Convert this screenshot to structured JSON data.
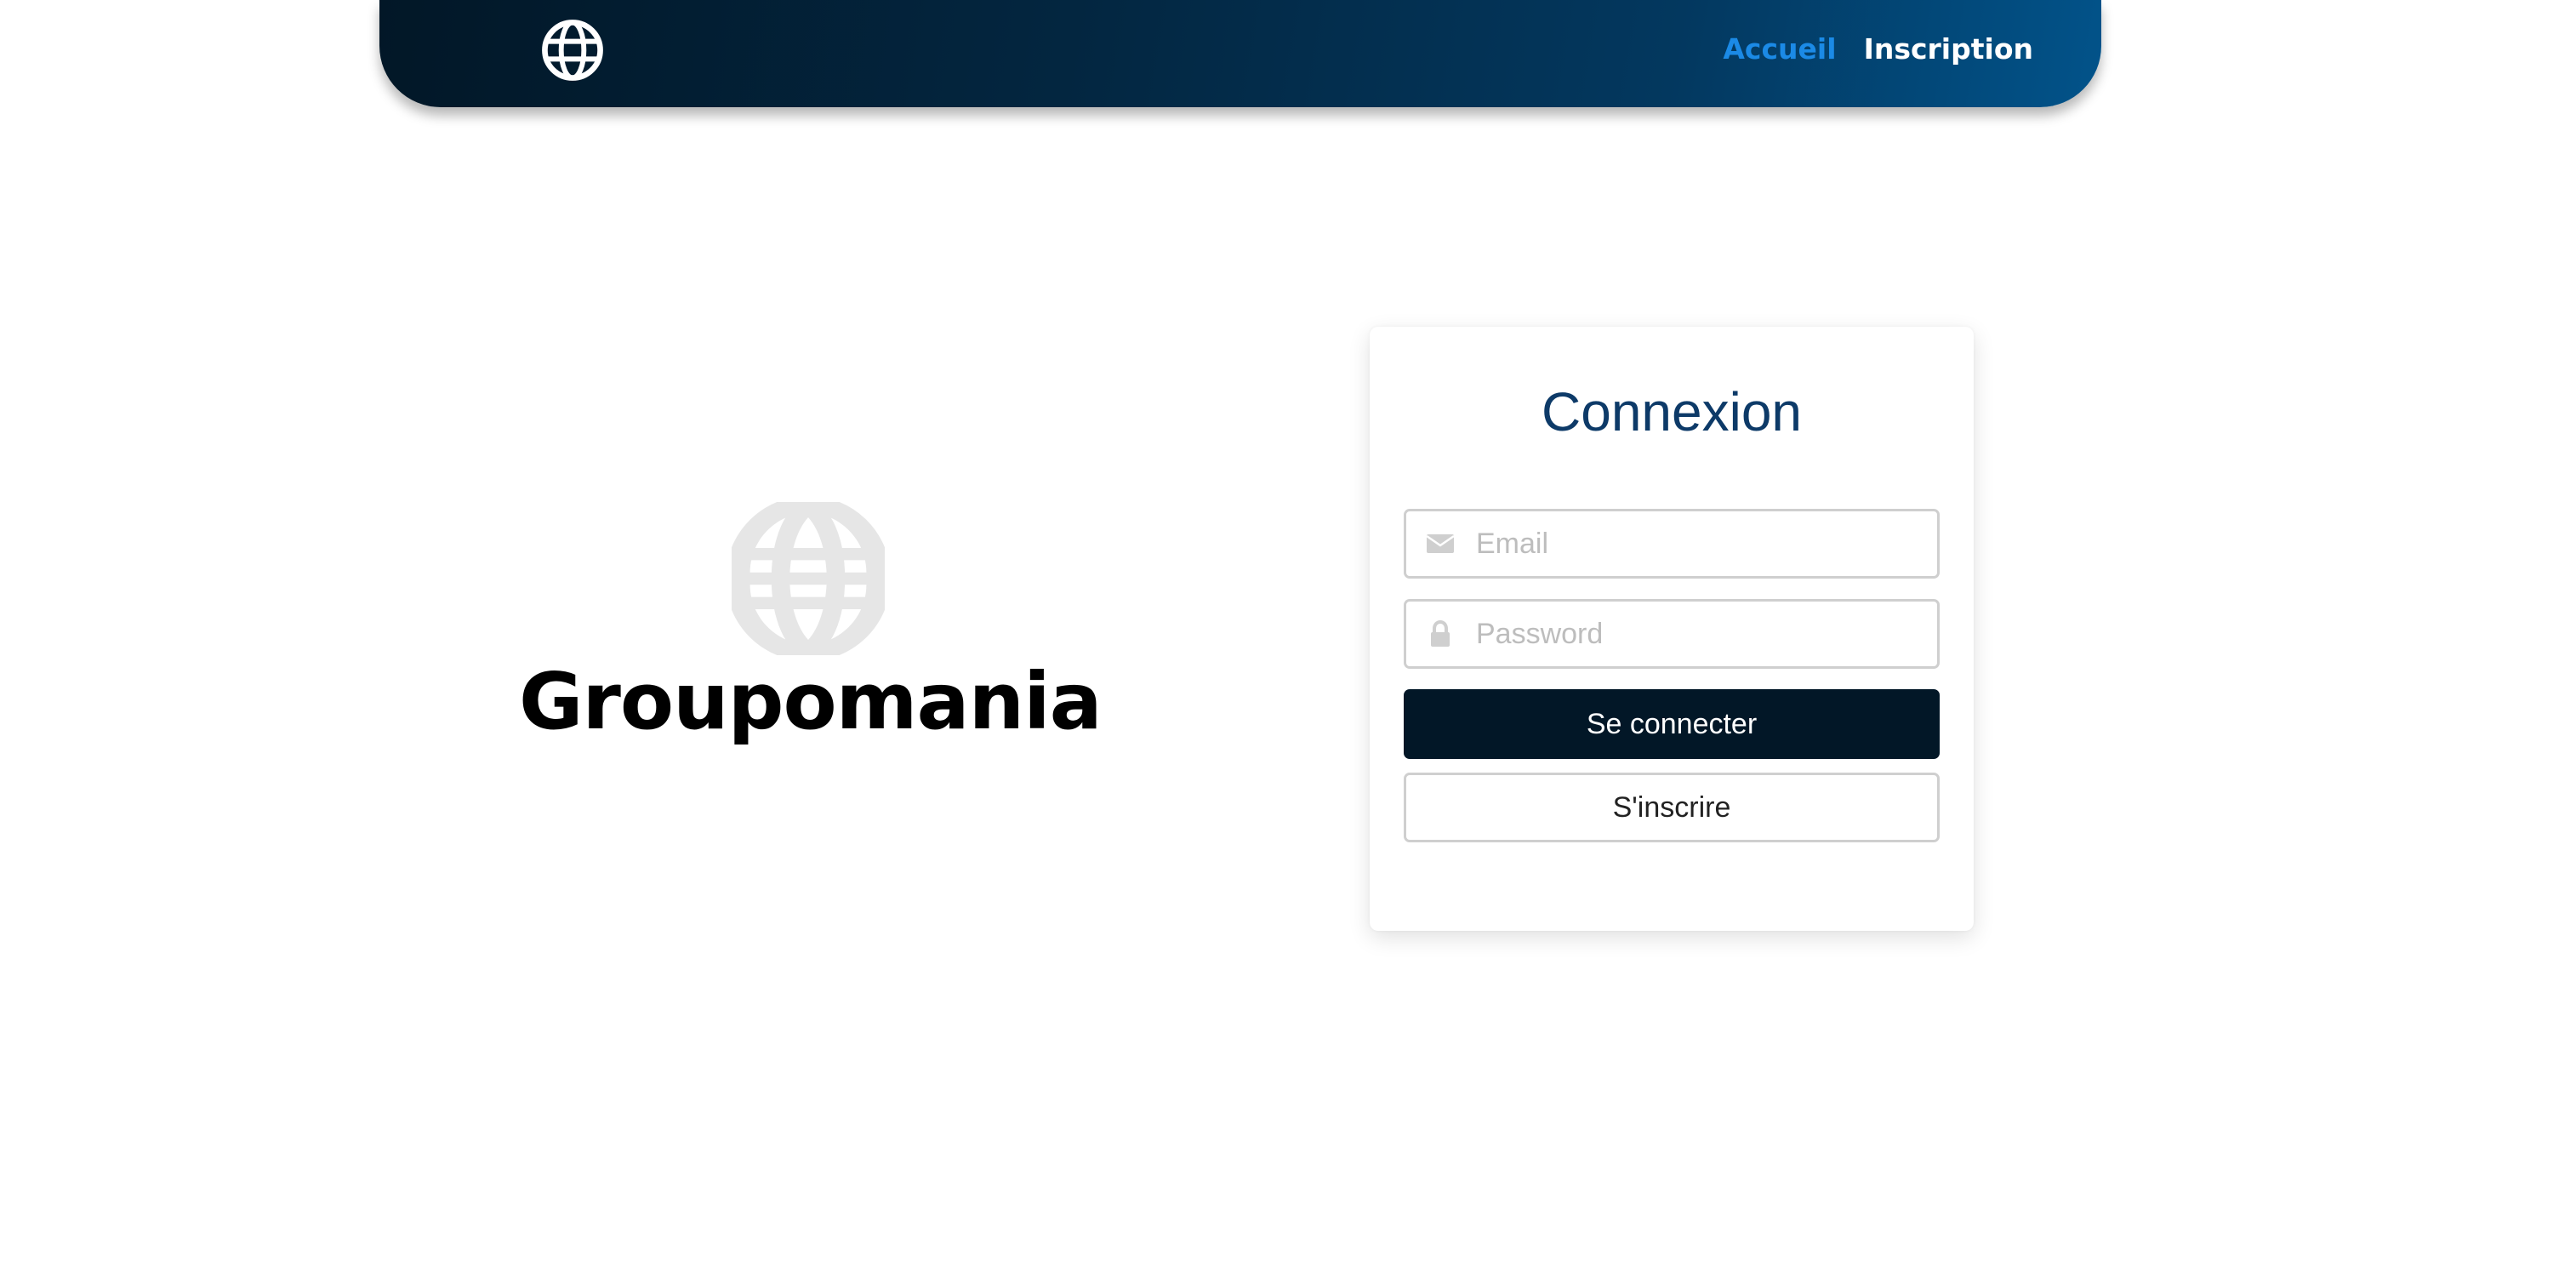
{
  "header": {
    "logo_icon": "globe-icon",
    "nav": {
      "home": "Accueil",
      "signup": "Inscription"
    },
    "colors": {
      "gradient_start": "#021727",
      "gradient_end": "#02538a",
      "active_link": "#1b8ae6"
    }
  },
  "brand": {
    "icon": "globe-icon",
    "name": "Groupomania"
  },
  "login": {
    "title": "Connexion",
    "email": {
      "icon": "envelope-icon",
      "placeholder": "Email",
      "value": ""
    },
    "password": {
      "icon": "lock-icon",
      "placeholder": "Password",
      "value": ""
    },
    "submit_label": "Se connecter",
    "register_label": "S'inscrire",
    "colors": {
      "title": "#0d3a68",
      "primary_button": "#021727"
    }
  }
}
